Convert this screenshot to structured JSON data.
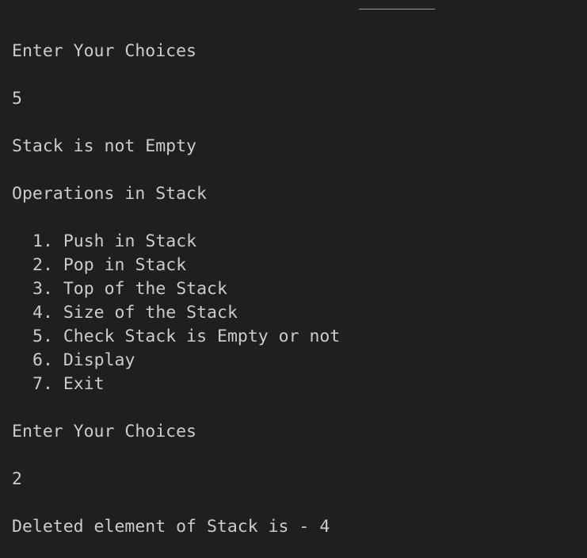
{
  "terminal": {
    "prompt_1": "Enter Your Choices",
    "input_1": "5",
    "result_1": "Stack is not Empty",
    "menu_title": "Operations in Stack",
    "menu": [
      "1. Push in Stack",
      "2. Pop in Stack",
      "3. Top of the Stack",
      "4. Size of the Stack",
      "5. Check Stack is Empty or not",
      "6. Display",
      "7. Exit"
    ],
    "prompt_2": "Enter Your Choices",
    "input_2": "2",
    "result_2": "Deleted element of Stack is - 4"
  },
  "colors": {
    "background": "#1f1f1f",
    "text": "#cccccc"
  }
}
